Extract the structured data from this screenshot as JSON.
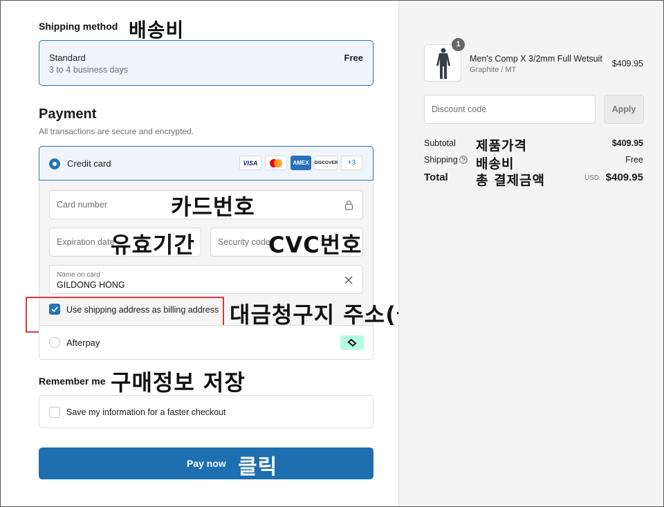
{
  "annotations": {
    "shipping_fee": "배송비",
    "card_number": "카드번호",
    "expiry": "유효기간",
    "cvc": "CVC번호",
    "billing_address": "대금청구지 주소(클릭o)",
    "save_info": "구매정보 저장",
    "click": "클릭",
    "product_price": "제품가격",
    "shipping_fee_2": "배송비",
    "total_payment": "총 결제금액"
  },
  "shipping": {
    "title": "Shipping method",
    "option_name": "Standard",
    "option_eta": "3 to 4 business days",
    "option_price": "Free"
  },
  "payment": {
    "title": "Payment",
    "subtitle": "All transactions are secure and encrypted.",
    "credit_card_label": "Credit card",
    "card_brands": [
      "VISA",
      "",
      "AMEX",
      "DISCOVER"
    ],
    "more_brands": "+3",
    "card_number_placeholder": "Card number",
    "expiration_placeholder": "Expiration date",
    "security_placeholder": "Security code",
    "name_label": "Name on card",
    "name_value": "GILDONG HONG",
    "billing_checkbox_label": "Use shipping address as billing address",
    "billing_checked": true,
    "afterpay_label": "Afterpay"
  },
  "remember": {
    "title": "Remember me",
    "save_label": "Save my information for a faster checkout",
    "save_checked": false
  },
  "pay_button": "Pay now",
  "summary": {
    "item_qty": "1",
    "item_name": "Men's Comp X 3/2mm Full Wetsuit",
    "item_variant": "Graphite / MT",
    "item_price": "$409.95",
    "discount_placeholder": "Discount code",
    "apply_label": "Apply",
    "subtotal_label": "Subtotal",
    "subtotal_value": "$409.95",
    "shipping_label": "Shipping",
    "shipping_value": "Free",
    "total_label": "Total",
    "total_currency": "USD",
    "total_value": "$409.95"
  },
  "colors": {
    "accent": "#2574b5",
    "pay_button": "#1d6fb0",
    "highlight_box": "#d9363e",
    "afterpay_badge": "#b2fce4"
  }
}
